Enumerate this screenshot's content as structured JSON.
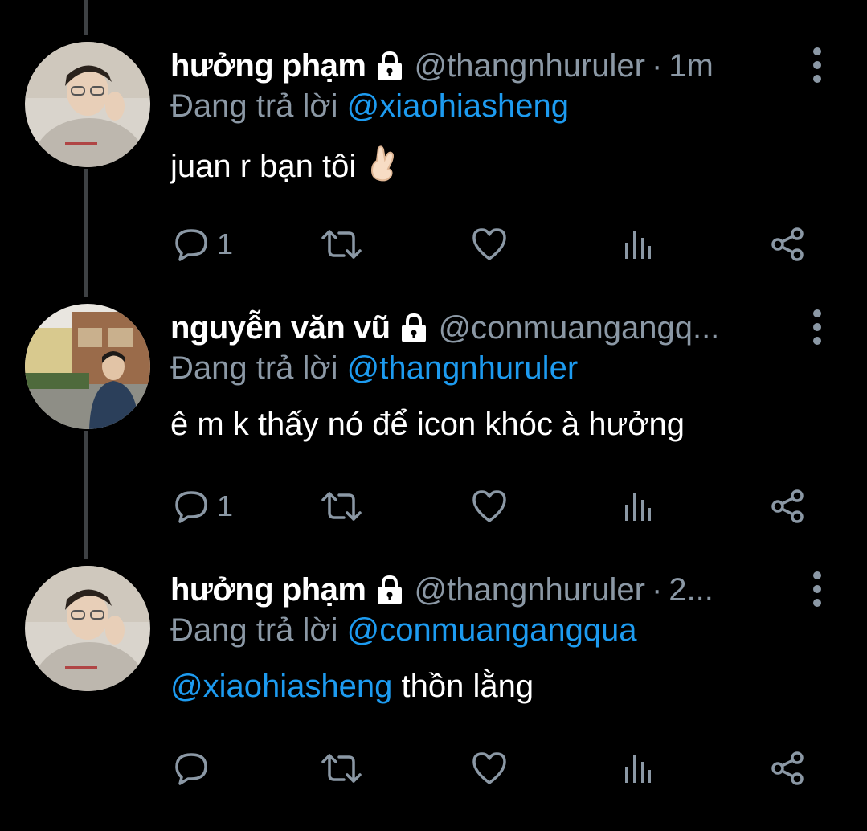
{
  "colors": {
    "background": "#000000",
    "text_primary": "#ffffff",
    "text_secondary": "#8b98a5",
    "accent": "#1d9bf0",
    "thread_line": "#3e4144"
  },
  "tweets": [
    {
      "display_name": "hưởng phạm",
      "protected_icon": "lock-icon",
      "handle": "@thangnhuruler",
      "separator": "·",
      "time": "1m",
      "reply_prefix": "Đang trả lời",
      "reply_to": "@xiaohiasheng",
      "text_mention": "",
      "text": "juan r bạn tôi",
      "emoji": "crossed-fingers-emoji",
      "reply_count": "1",
      "retweet_count": "",
      "like_count": ""
    },
    {
      "display_name": "nguyễn văn vũ",
      "protected_icon": "lock-icon",
      "handle": "@conmuangangq...",
      "separator": "",
      "time": "",
      "reply_prefix": "Đang trả lời",
      "reply_to": "@thangnhuruler",
      "text_mention": "",
      "text": "ê m k thấy nó để icon khóc à hưởng",
      "emoji": "",
      "reply_count": "1",
      "retweet_count": "",
      "like_count": ""
    },
    {
      "display_name": "hưởng phạm",
      "protected_icon": "lock-icon",
      "handle": "@thangnhuruler",
      "separator": "·",
      "time": "2...",
      "reply_prefix": "Đang trả lời",
      "reply_to": "@conmuangangqua",
      "text_mention": "@xiaohiasheng",
      "text": " thồn lằng",
      "emoji": "",
      "reply_count": "",
      "retweet_count": "",
      "like_count": ""
    }
  ]
}
